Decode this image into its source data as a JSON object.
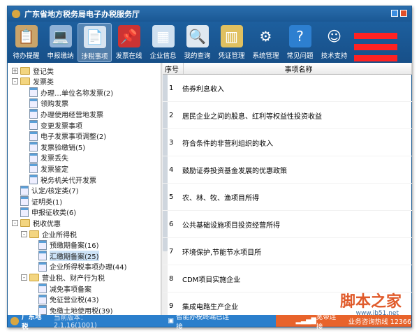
{
  "window": {
    "title": "广东省地方税务局电子办税服务厅"
  },
  "toolbar": [
    {
      "label": "待办提醒",
      "icon": "clipboard-icon"
    },
    {
      "label": "申报缴纳",
      "icon": "laptop-icon"
    },
    {
      "label": "涉税事项",
      "icon": "document-arrow-icon",
      "active": true
    },
    {
      "label": "发票在线",
      "icon": "stamp-icon"
    },
    {
      "label": "企业信息",
      "icon": "building-doc-icon"
    },
    {
      "label": "我的查询",
      "icon": "magnifier-icon"
    },
    {
      "label": "凭证管理",
      "icon": "binders-icon"
    },
    {
      "label": "系统管理",
      "icon": "gear-icon"
    },
    {
      "label": "常见问题",
      "icon": "help-icon"
    },
    {
      "label": "技术支持",
      "icon": "support-agent-icon"
    }
  ],
  "tree": [
    {
      "label": "登记类",
      "level": 0,
      "type": "folder",
      "exp": "+"
    },
    {
      "label": "发票类",
      "level": 0,
      "type": "folder",
      "exp": "-"
    },
    {
      "label": "办理…单位名称发票(2)",
      "level": 1,
      "type": "doc"
    },
    {
      "label": "领购发票",
      "level": 1,
      "type": "doc"
    },
    {
      "label": "办理使用经营地发票",
      "level": 1,
      "type": "doc"
    },
    {
      "label": "变更发票事项",
      "level": 1,
      "type": "doc"
    },
    {
      "label": "电子发票事项调整(2)",
      "level": 1,
      "type": "doc"
    },
    {
      "label": "发票验缴销(5)",
      "level": 1,
      "type": "doc"
    },
    {
      "label": "发票丢失",
      "level": 1,
      "type": "doc"
    },
    {
      "label": "发票鉴定",
      "level": 1,
      "type": "doc"
    },
    {
      "label": "税务机关代开发票",
      "level": 1,
      "type": "doc"
    },
    {
      "label": "认定/核定类(7)",
      "level": 0,
      "type": "doc"
    },
    {
      "label": "证明类(1)",
      "level": 0,
      "type": "doc"
    },
    {
      "label": "申报征收类(6)",
      "level": 0,
      "type": "doc"
    },
    {
      "label": "税收优惠",
      "level": 0,
      "type": "folder",
      "exp": "-"
    },
    {
      "label": "企业所得税",
      "level": 1,
      "type": "folder",
      "exp": "-"
    },
    {
      "label": "预缴期备案(16)",
      "level": 2,
      "type": "doc"
    },
    {
      "label": "汇缴期备案(25)",
      "level": 2,
      "type": "doc",
      "selected": true
    },
    {
      "label": "企业所得税事项办理(44)",
      "level": 2,
      "type": "doc"
    },
    {
      "label": "营业税、财产行为税",
      "level": 1,
      "type": "folder",
      "exp": "-"
    },
    {
      "label": "减免事项备案",
      "level": 2,
      "type": "doc"
    },
    {
      "label": "免征营业税(43)",
      "level": 2,
      "type": "doc"
    },
    {
      "label": "免缴土地使用税(39)",
      "level": 2,
      "type": "doc"
    }
  ],
  "grid": {
    "col_no": "序号",
    "col_name": "事项名称",
    "rows": [
      {
        "no": "1",
        "name": "债券利息收入"
      },
      {
        "no": "2",
        "name": "居民企业之间的股息、红利等权益性投资收益"
      },
      {
        "no": "3",
        "name": "符合条件的非营利组织的收入"
      },
      {
        "no": "4",
        "name": "鼓励证券投资基金发展的优惠政策"
      },
      {
        "no": "5",
        "name": "农、林、牧、渔项目所得"
      },
      {
        "no": "6",
        "name": "公共基础设施项目投资经营所得"
      },
      {
        "no": "7",
        "name": "环境保护,节能节水项目所"
      },
      {
        "no": "8",
        "name": "CDM项目实施企业"
      },
      {
        "no": "9",
        "name": "集成电路生产企业"
      }
    ]
  },
  "status": {
    "org": "广东地税",
    "version": "当前版本：2.1.16(1001)",
    "terminal": "智能办税终端已连接",
    "network": "宽带连接",
    "hotline": "业务咨询热线 12366"
  },
  "watermark": {
    "text": "脚本之家",
    "url": "www.jb51.net"
  }
}
